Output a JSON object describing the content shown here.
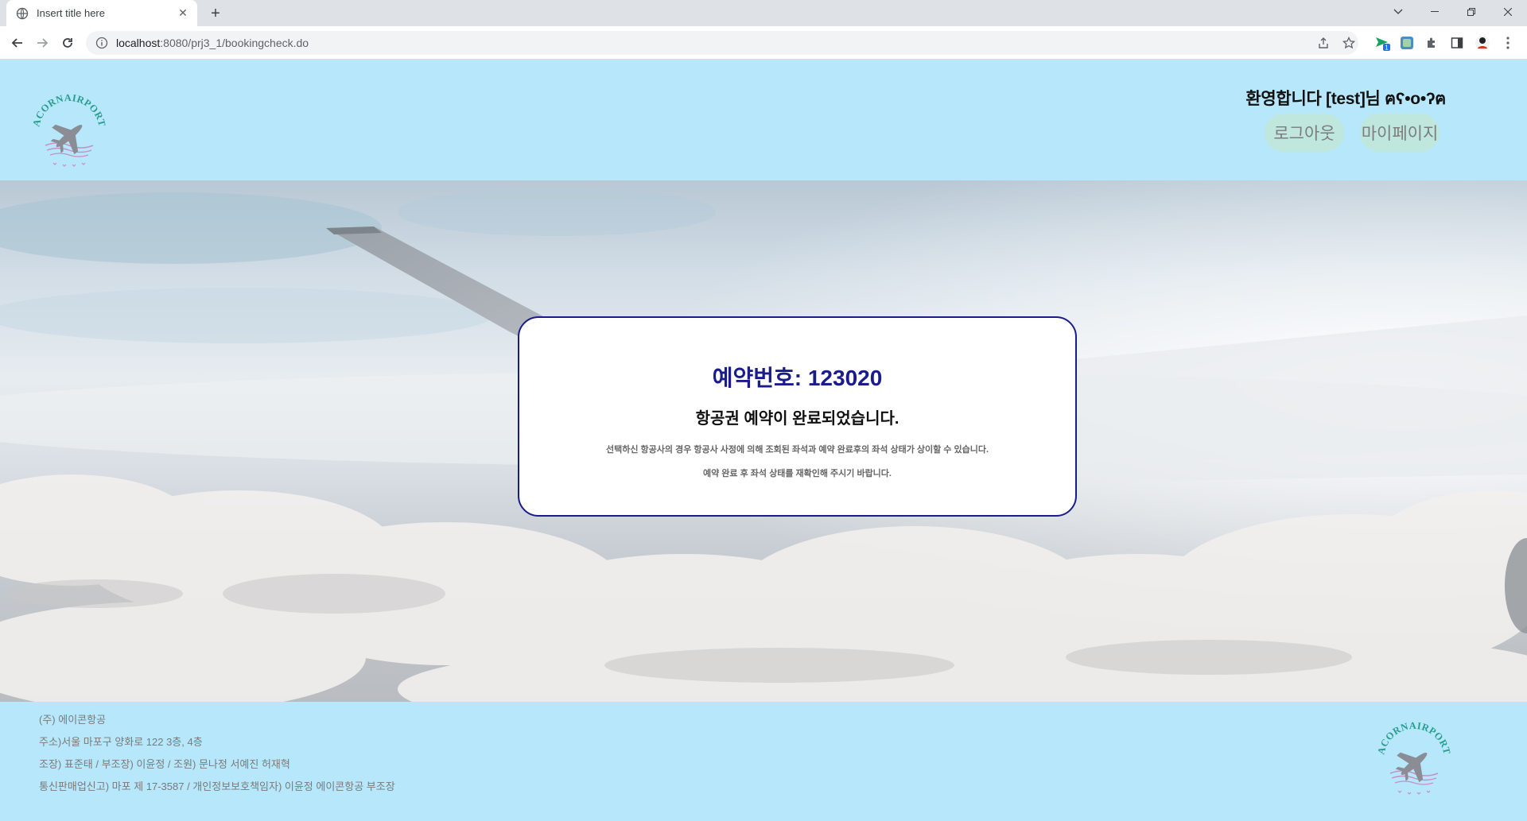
{
  "browser": {
    "tab_title": "Insert title here",
    "url_host": "localhost",
    "url_rest": ":8080/prj3_1/bookingcheck.do",
    "extension_badge": "1"
  },
  "header": {
    "logo_text": "ACORNAIRPORT",
    "welcome": "환영합니다 [test]님 ฅʕ•ο•ʔฅ",
    "logout_label": "로그아웃",
    "mypage_label": "마이페이지"
  },
  "confirmation": {
    "reservation_number": "예약번호: 123020",
    "completed_message": "항공권 예약이 완료되었습니다.",
    "notice_1": "선택하신 항공사의 경우 항공사 사정에 의해 조회된 좌석과 예약 완료후의 좌석 상태가 상이할 수 있습니다.",
    "notice_2": "예약 완료 후 좌석 상태를 재확인해 주시기 바랍니다."
  },
  "footer": {
    "company": "(주) 에이콘항공",
    "address": "주소)서울 마포구 양화로 122 3층, 4층",
    "team": "조장) 표준태 / 부조장) 이윤정 / 조원) 문나정 서예진 허재혁",
    "registration": "통신판매업신고) 마포 제 17-3587 / 개인정보보호책임자) 이윤정 에이콘항공 부조장",
    "logo_text": "ACORNAIRPORT"
  },
  "colors": {
    "page_background": "#b7e7fb",
    "card_border": "#1a1c8c",
    "reservation_text": "#1a1c8c",
    "pill_background": "#bfe7dd",
    "logo_text": "#2a9d8f",
    "logo_plane": "#8a8d94",
    "logo_waves": "#c78fc2"
  }
}
